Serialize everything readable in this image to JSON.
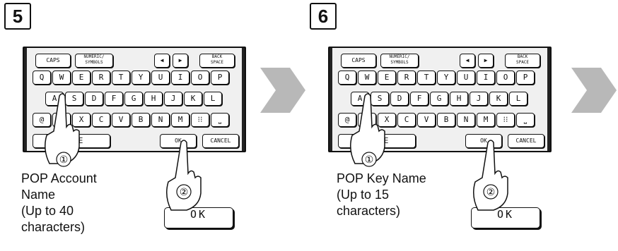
{
  "steps": [
    {
      "number": "5",
      "caption_lines": [
        "POP Account",
        "Name",
        "(Up to 40",
        "characters)"
      ]
    },
    {
      "number": "6",
      "caption_lines": [
        "POP Key Name",
        "(Up to 15",
        "characters)"
      ]
    }
  ],
  "keyboard": {
    "caps": "CAPS",
    "numeric_line1": "NUMERIC/",
    "numeric_line2": "SYMBOLS",
    "left_arrow": "◀",
    "right_arrow": "▶",
    "back_line1": "BACK",
    "back_line2": "SPACE",
    "row1": [
      "Q",
      "W",
      "E",
      "R",
      "T",
      "Y",
      "U",
      "I",
      "O",
      "P"
    ],
    "row2": [
      "A",
      "S",
      "D",
      "F",
      "G",
      "H",
      "J",
      "K",
      "L"
    ],
    "row3": [
      "@",
      "Z",
      "X",
      "C",
      "V",
      "B",
      "N",
      "M",
      "⁝⁝",
      "⎵"
    ],
    "space_fragment": "E",
    "ok": "OK",
    "cancel": "CANCEL"
  },
  "ok_button_label": "OK",
  "callouts": {
    "first": "①",
    "second": "②"
  },
  "colors": {
    "chevron": "#b8b8b8",
    "panel_bg": "#f0f0f0"
  }
}
